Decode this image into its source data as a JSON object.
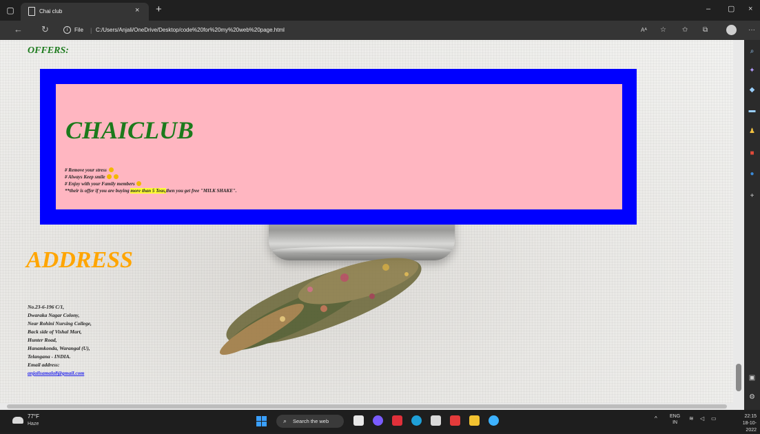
{
  "browser": {
    "tab_title": "Chai club",
    "tab_close": "×",
    "new_tab": "+",
    "file_label": "File",
    "separator": "|",
    "url": "C:/Users/Anjali/OneDrive/Desktop/code%20for%20my%20web%20page.html",
    "read_aloud": "Aᴬ",
    "window_controls": {
      "minimize": "–",
      "restore": "▢",
      "close": "×"
    },
    "more": "···"
  },
  "page": {
    "offers_heading": "OFFERS:",
    "brand": "CHAICLUB",
    "points": [
      "# Remove your stress",
      "# Always Keep smile",
      "# Enjoy with your Family members"
    ],
    "offer_prefix": "**their is offer if you are buying ",
    "offer_highlight": "more than 5 Teas,",
    "offer_suffix": "then you get free \"MILK SHAKE\".",
    "address_heading": "ADDRESS",
    "address_lines": [
      "No.23-6-196 C/1,",
      "Dwaraka Nagar Colony,",
      "Near Rohini Nursing College,",
      "Back side of Vishal Mart,",
      "Hunter Road,",
      "Hanamkonda, Warangal (U),",
      "Telangana - INDIA."
    ],
    "email_label": "Email address:",
    "email": "anjalisamala8@gmail.com"
  },
  "colors": {
    "banner_border": "#0000ff",
    "banner_fill": "#ffb6c1",
    "brand": "#1c7a1c",
    "address_heading": "#ffa500",
    "highlight": "#ffff33"
  },
  "taskbar": {
    "temperature": "77°F",
    "condition": "Haze",
    "search_placeholder": "Search the web",
    "language": "ENG",
    "region": "IN",
    "time": "22:15",
    "date": "18-10-2022"
  }
}
